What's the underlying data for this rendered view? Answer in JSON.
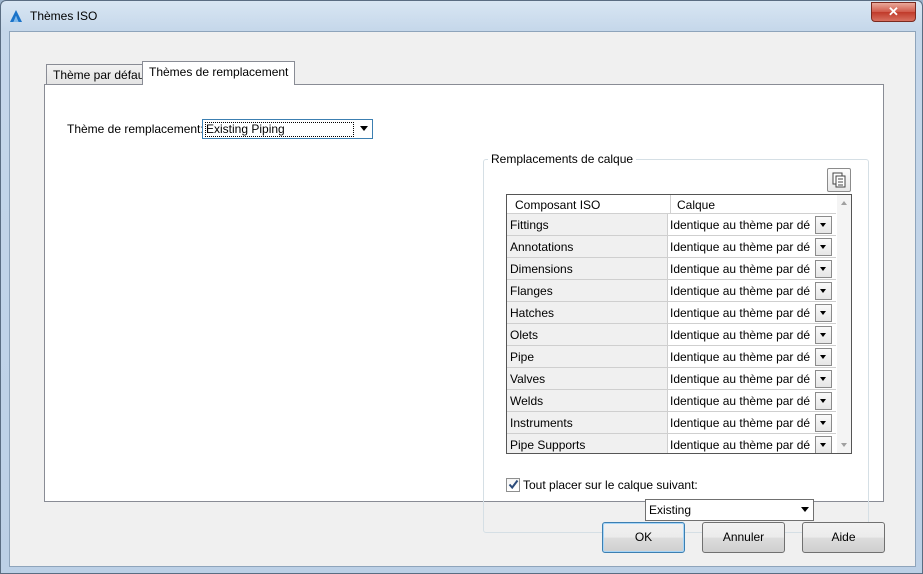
{
  "window": {
    "title": "Thèmes ISO",
    "close_label": "✕"
  },
  "tabs": [
    {
      "label": "Thème par défaut",
      "active": false
    },
    {
      "label": "Thèmes de remplacement",
      "active": true
    }
  ],
  "replacement_theme": {
    "label": "Thème de remplacement:",
    "value": "Existing Piping"
  },
  "layer_replacements": {
    "title": "Remplacements de calque",
    "columns": [
      "Composant ISO",
      "Calque"
    ],
    "rows": [
      {
        "component": "Fittings",
        "layer": "Identique au thème par déf..."
      },
      {
        "component": "Annotations",
        "layer": "Identique au thème par déf..."
      },
      {
        "component": "Dimensions",
        "layer": "Identique au thème par déf..."
      },
      {
        "component": "Flanges",
        "layer": "Identique au thème par déf..."
      },
      {
        "component": "Hatches",
        "layer": "Identique au thème par déf..."
      },
      {
        "component": "Olets",
        "layer": "Identique au thème par déf..."
      },
      {
        "component": "Pipe",
        "layer": "Identique au thème par déf..."
      },
      {
        "component": "Valves",
        "layer": "Identique au thème par déf..."
      },
      {
        "component": "Welds",
        "layer": "Identique au thème par déf..."
      },
      {
        "component": "Instruments",
        "layer": "Identique au thème par déf..."
      },
      {
        "component": "Pipe Supports",
        "layer": "Identique au thème par déf..."
      }
    ],
    "place_all": {
      "label": "Tout placer sur le calque suivant:",
      "checked": true
    },
    "layer_value": "Existing"
  },
  "buttons": {
    "ok": "OK",
    "cancel": "Annuler",
    "help": "Aide"
  },
  "colors": {
    "accent": "#3c7fb1",
    "close": "#c03a2a"
  }
}
